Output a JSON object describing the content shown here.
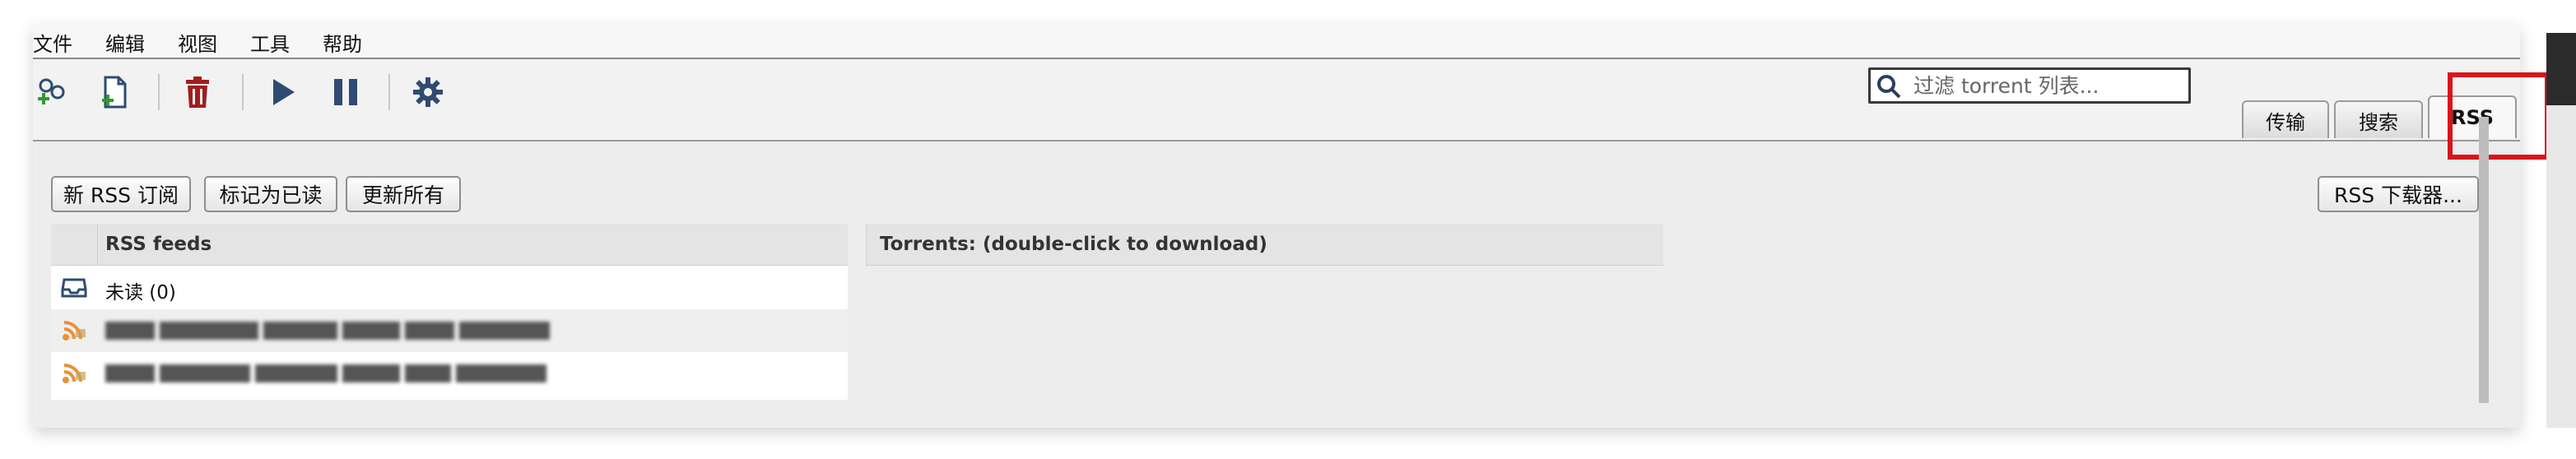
{
  "menubar": {
    "items": [
      "文件",
      "编辑",
      "视图",
      "工具",
      "帮助"
    ]
  },
  "toolbar": {
    "icons": [
      "add-torrent-link-icon",
      "add-torrent-file-icon",
      "trash-icon",
      "play-icon",
      "pause-icon",
      "gear-icon"
    ],
    "search": {
      "placeholder": "过滤 torrent 列表..."
    }
  },
  "tabs": [
    {
      "label": "传输",
      "active": false
    },
    {
      "label": "搜索",
      "active": false
    },
    {
      "label": "RSS",
      "active": true
    }
  ],
  "rss": {
    "buttons": {
      "new_subscription": "新 RSS 订阅",
      "mark_read": "标记为已读",
      "update_all": "更新所有",
      "downloader": "RSS 下载器..."
    },
    "feeds_header": "RSS feeds",
    "feeds": [
      {
        "label": "未读 (0)",
        "icon": "inbox-icon"
      },
      {
        "label": "",
        "icon": "rss-icon",
        "blurred": true
      },
      {
        "label": "",
        "icon": "rss-icon",
        "blurred": true
      }
    ],
    "torrents_header": "Torrents: (double-click to download)"
  },
  "colors": {
    "highlight": "#d9141b",
    "trash": "#a11d1d",
    "toolbar_icon": "#2f4b73",
    "rss_orange": "#e8913a"
  }
}
